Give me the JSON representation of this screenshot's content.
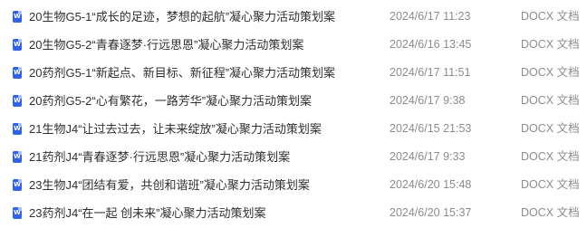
{
  "icon": {
    "name": "word-doc-icon",
    "glyph": "W",
    "color": "#2f64e8"
  },
  "files": [
    {
      "name": "20生物G5-1“成长的足迹，梦想的起航”凝心聚力活动策划案",
      "date": "2024/6/17 11:23",
      "type": "DOCX 文档"
    },
    {
      "name": "20生物G5-2“青春逐梦·行远思恩”凝心聚力活动策划案",
      "date": "2024/6/16 13:45",
      "type": "DOCX 文档"
    },
    {
      "name": "20药剂G5-1“新起点、新目标、新征程”凝心聚力活动策划案",
      "date": "2024/6/17 11:51",
      "type": "DOCX 文档"
    },
    {
      "name": "20药剂G5-2“心有繁花，一路芳华”凝心聚力活动策划案",
      "date": "2024/6/17 9:38",
      "type": "DOCX 文档"
    },
    {
      "name": "21生物J4“让过去过去，让未来绽放”凝心聚力活动策划案",
      "date": "2024/6/15 21:53",
      "type": "DOCX 文档"
    },
    {
      "name": "21药剂J4“青春逐梦·行远思恩”凝心聚力活动策划案",
      "date": "2024/6/17 9:33",
      "type": "DOCX 文档"
    },
    {
      "name": "23生物J4“团结有爱，共创和谐班”凝心聚力活动策划案",
      "date": "2024/6/20 15:48",
      "type": "DOCX 文档"
    },
    {
      "name": "23药剂J4“在一起 创未来”凝心聚力活动策划案",
      "date": "2024/6/20 15:37",
      "type": "DOCX 文档"
    }
  ]
}
